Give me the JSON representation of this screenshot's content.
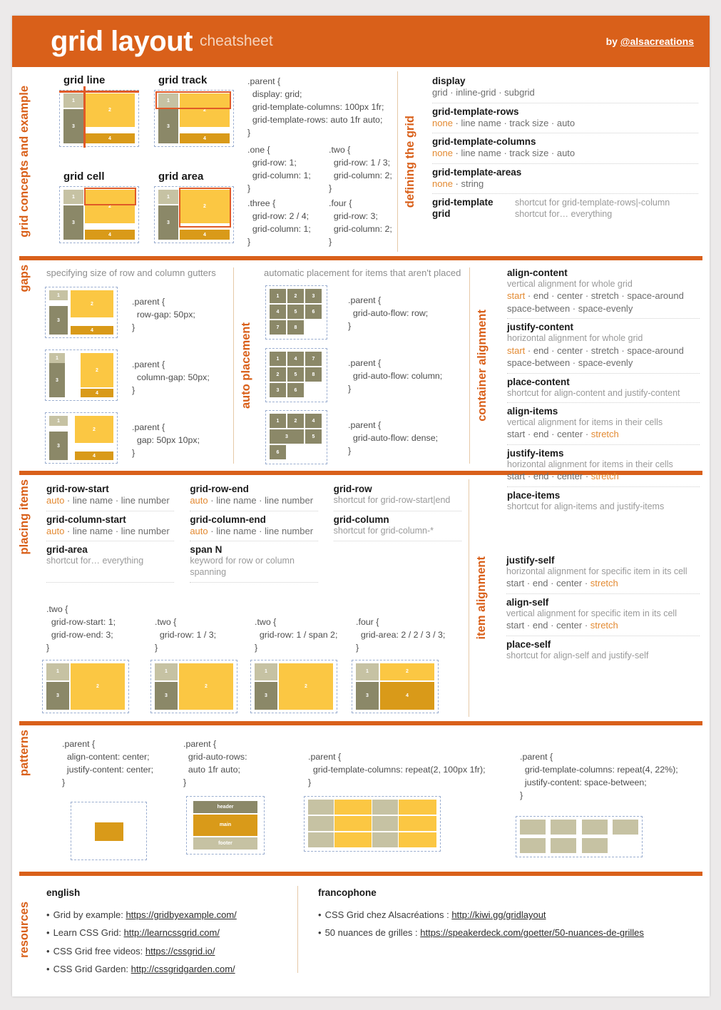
{
  "header": {
    "title": "grid layout",
    "subtitle": "cheatsheet",
    "byline_prefix": "by ",
    "byline_handle": "@alsacreations"
  },
  "sections": {
    "concepts_label": "grid concepts and example",
    "defining_label": "defining the grid",
    "gaps_label": "gaps",
    "autoplacement_label": "auto placement",
    "container_alignment_label": "container alignment",
    "placing_items_label": "placing items",
    "item_alignment_label": "item alignment",
    "patterns_label": "patterns",
    "resources_label": "resources"
  },
  "concepts": {
    "diagrams": [
      {
        "title": "grid line"
      },
      {
        "title": "grid track"
      },
      {
        "title": "grid cell"
      },
      {
        "title": "grid area"
      }
    ],
    "code_parent": ".parent {\n  display: grid;\n  grid-template-columns: 100px 1fr;\n  grid-template-rows: auto 1fr auto;\n}",
    "code_one": ".one {\n  grid-row: 1;\n  grid-column: 1;\n}",
    "code_two": ".two {\n  grid-row: 1 / 3;\n  grid-column: 2;\n}",
    "code_three": ".three {\n  grid-row: 2 / 4;\n  grid-column: 1;\n}",
    "code_four": ".four {\n  grid-row: 3;\n  grid-column: 2;\n}"
  },
  "defining": [
    {
      "name": "display",
      "values_plain": "grid · inline-grid · subgrid"
    },
    {
      "name": "grid-template-rows",
      "keyword": "none",
      "values_plain": " · line name · track size · auto"
    },
    {
      "name": "grid-template-columns",
      "keyword": "none",
      "values_plain": " · line name · track size · auto"
    },
    {
      "name": "grid-template-areas",
      "keyword": "none",
      "values_plain": " · string"
    }
  ],
  "defining_shortcuts": [
    {
      "name": "grid-template",
      "desc": "shortcut for grid-template-rows|-column"
    },
    {
      "name": "grid",
      "desc": "shortcut for… everything"
    }
  ],
  "gaps": {
    "caption": "specifying size of row and column gutters",
    "examples": [
      {
        "code": ".parent {\n  row-gap: 50px;\n}"
      },
      {
        "code": ".parent {\n  column-gap: 50px;\n}"
      },
      {
        "code": ".parent {\n  gap: 50px 10px;\n}"
      }
    ]
  },
  "autoplacement": {
    "caption": "automatic placement for items that aren't placed",
    "examples": [
      {
        "code": ".parent {\n  grid-auto-flow: row;\n}",
        "cells": [
          "1",
          "2",
          "3",
          "4",
          "5",
          "6",
          "7",
          "8"
        ]
      },
      {
        "code": ".parent {\n  grid-auto-flow: column;\n}",
        "cells": [
          "1",
          "4",
          "7",
          "2",
          "5",
          "8",
          "3",
          "6"
        ]
      },
      {
        "code": ".parent {\n  grid-auto-flow: dense;\n}",
        "cells": [
          "1",
          "2",
          "4",
          "3",
          "5",
          "6"
        ]
      }
    ]
  },
  "container_alignment": [
    {
      "name": "align-content",
      "desc": "vertical alignment for whole grid",
      "keyword": "start",
      "values_plain": " · end · center · stretch · space-around",
      "values_line2": "space-between · space-evenly"
    },
    {
      "name": "justify-content",
      "desc": "horizontal alignment for whole grid",
      "keyword": "start",
      "values_plain": " · end · center · stretch · space-around",
      "values_line2": "space-between · space-evenly"
    },
    {
      "name": "place-content",
      "desc": "shortcut for align-content and justify-content"
    },
    {
      "name": "align-items",
      "desc": "vertical alignment for items in their cells",
      "values_pre": "start · end · center · ",
      "keyword_post": "stretch"
    },
    {
      "name": "justify-items",
      "desc": "horizontal alignment for items in their cells",
      "values_pre": "start · end · center · ",
      "keyword_post": "stretch"
    },
    {
      "name": "place-items",
      "desc": "shortcut for align-items and justify-items"
    }
  ],
  "item_alignment": [
    {
      "name": "justify-self",
      "desc": "horizontal alignment for specific item in its cell",
      "values_pre": "start · end · center · ",
      "keyword_post": "stretch"
    },
    {
      "name": "align-self",
      "desc": "vertical alignment for specific item in its cell",
      "values_pre": "start · end · center · ",
      "keyword_post": "stretch"
    },
    {
      "name": "place-self",
      "desc": "shortcut for align-self and justify-self"
    }
  ],
  "placing_items": [
    {
      "name": "grid-row-start",
      "keyword": "auto",
      "values_plain": " · line name · line number"
    },
    {
      "name": "grid-row-end",
      "keyword": "auto",
      "values_plain": " · line name · line number"
    },
    {
      "name": "grid-row",
      "desc": "shortcut for grid-row-start|end"
    },
    {
      "name": "grid-column-start",
      "keyword": "auto",
      "values_plain": " · line name · line number"
    },
    {
      "name": "grid-column-end",
      "keyword": "auto",
      "values_plain": " · line name · line number"
    },
    {
      "name": "grid-column",
      "desc": "shortcut for grid-column-*"
    },
    {
      "name": "grid-area",
      "desc": "shortcut for… everything"
    },
    {
      "name": "span N",
      "desc": "keyword for row or column spanning"
    }
  ],
  "placing_examples": [
    {
      "code": ".two {\n  grid-row-start: 1;\n  grid-row-end: 3;\n}"
    },
    {
      "code": ".two {\n  grid-row: 1 / 3;\n}"
    },
    {
      "code": ".two {\n  grid-row: 1 / span 2;\n}"
    },
    {
      "code": ".four {\n  grid-area: 2 / 2 / 3 / 3;\n}"
    }
  ],
  "patterns": [
    {
      "code": ".parent {\n  align-content: center;\n  justify-content: center;\n}"
    },
    {
      "code": ".parent {\n  grid-auto-rows:\n  auto 1fr auto;\n}",
      "labels": [
        "header",
        "main",
        "footer"
      ]
    },
    {
      "code": ".parent {\n  grid-template-columns: repeat(2, 100px 1fr);\n}"
    },
    {
      "code": ".parent {\n  grid-template-columns: repeat(4, 22%);\n  justify-content: space-between;\n}"
    }
  ],
  "resources": {
    "english_title": "english",
    "english_items": [
      {
        "text": "Grid by example: ",
        "link": "https://gridbyexample.com/"
      },
      {
        "text": "Learn CSS Grid: ",
        "link": "http://learncssgrid.com/"
      },
      {
        "text": "CSS Grid free videos: ",
        "link": "https://cssgrid.io/"
      },
      {
        "text": "CSS Grid Garden: ",
        "link": "http://cssgridgarden.com/"
      }
    ],
    "francophone_title": "francophone",
    "francophone_items": [
      {
        "text": "CSS Grid chez Alsacréations : ",
        "link": "http://kiwi.gg/gridlayout"
      },
      {
        "text": "50 nuances de grilles : ",
        "link": "https://speakerdeck.com/goetter/50-nuances-de-grilles"
      }
    ]
  },
  "colors": {
    "accent": "#d9601a",
    "keyword": "#e38a32",
    "cell1": "#c6c2a3",
    "cell2": "#fbc743",
    "cell3": "#8b8868",
    "cell4": "#d99a19",
    "highlight": "#e05a27"
  }
}
